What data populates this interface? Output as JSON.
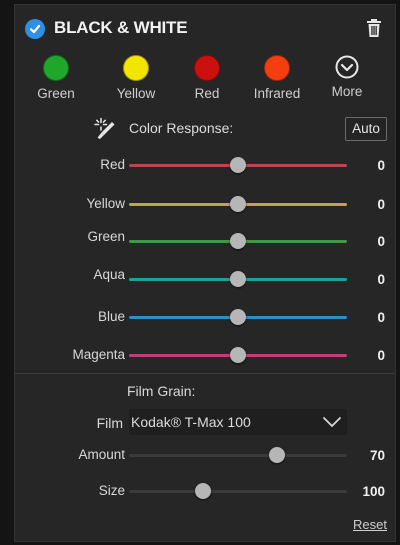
{
  "header": {
    "title": "BLACK & WHITE",
    "enabled_icon": "check-circle-icon",
    "delete_icon": "trash-icon"
  },
  "filters": [
    {
      "label": "Green",
      "color": "#1ea72a"
    },
    {
      "label": "Yellow",
      "color": "#f2e600"
    },
    {
      "label": "Red",
      "color": "#cc1010"
    },
    {
      "label": "Infrared",
      "color": "#f53e0f"
    },
    {
      "label": "More",
      "icon": "chevron-circle-down-icon"
    }
  ],
  "color_response": {
    "label": "Color Response:",
    "auto_label": "Auto",
    "picker_icon": "eyedropper-sparkle-icon"
  },
  "sliders": [
    {
      "label": "Red",
      "value": "0",
      "level": 0.5,
      "color": "#b8464e"
    },
    {
      "label": "Yellow",
      "value": "0",
      "level": 0.5,
      "color": "#c3a24a"
    },
    {
      "label": "Green",
      "value": "0",
      "level": 0.5,
      "color": "#3f9a42"
    },
    {
      "label": "Aqua",
      "value": "0",
      "level": 0.5,
      "color": "#1ea0a0"
    },
    {
      "label": "Blue",
      "value": "0",
      "level": 0.5,
      "color": "#2e8fc6"
    },
    {
      "label": "Magenta",
      "value": "0",
      "level": 0.5,
      "color": "#c23e79"
    }
  ],
  "film_grain": {
    "title": "Film Grain:",
    "film_label": "Film",
    "film_value": "Kodak® T-Max 100",
    "amount_label": "Amount",
    "amount_value": "70",
    "amount_level": 0.68,
    "size_label": "Size",
    "size_value": "100",
    "size_level": 0.34,
    "grain_color": "#3a3a3a"
  },
  "reset_label": "Reset"
}
